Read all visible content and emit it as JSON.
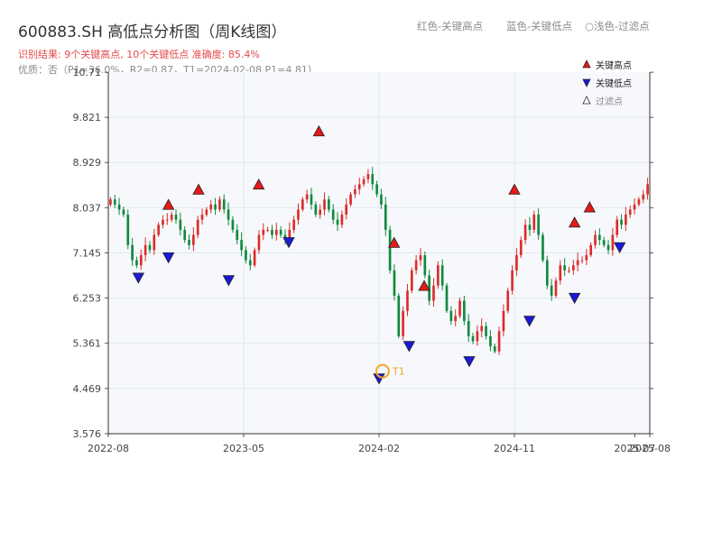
{
  "header": {
    "title": "600883.SH 高低点分析图（周K线图）",
    "result": "识别结果: 9个关键高点, 10个关键低点  准确度: 85.4%",
    "quality": "优质：否（P1=36.0%，R2=0.87，T1=2024-02-08 P1=4.81）"
  },
  "top_legend": [
    {
      "text": "红色-关键高点"
    },
    {
      "text": "蓝色-关键低点"
    },
    {
      "text": "○浅色-过滤点"
    }
  ],
  "colors": {
    "up": "#dc2c2c",
    "down": "#0e8a3e",
    "high_marker": "#e81818",
    "low_marker": "#1a1ad8",
    "t1_ring": "#f5a623",
    "plot_bg": "#f6f8fb"
  },
  "chart_data": {
    "type": "candlestick",
    "title": "600883.SH 高低点分析图（周K线图）",
    "x_tick_labels": [
      "2022-08",
      "2023-05",
      "2024-02",
      "2024-11",
      "2025-07",
      "2025-08"
    ],
    "y_tick_labels": [
      "3.576",
      "4.469",
      "5.361",
      "6.253",
      "7.145",
      "8.037",
      "8.929",
      "9.821",
      "10.71"
    ],
    "ylim": [
      3.576,
      10.713
    ],
    "x_start": "2022-08",
    "x_end": "2025-08",
    "grid": true,
    "legend": {
      "position": "top-right",
      "entries": [
        "关键高点",
        "关键低点",
        "过滤点"
      ]
    },
    "annotation": {
      "label": "T1",
      "date": "2024-02-08",
      "price": 4.81
    },
    "closes": [
      8.2,
      8.1,
      8.0,
      7.9,
      7.3,
      7.0,
      6.9,
      7.1,
      7.3,
      7.2,
      7.5,
      7.7,
      7.8,
      7.8,
      7.9,
      7.8,
      7.6,
      7.4,
      7.3,
      7.5,
      7.8,
      7.9,
      8.0,
      8.1,
      8.0,
      8.2,
      8.0,
      7.8,
      7.6,
      7.4,
      7.2,
      7.0,
      6.9,
      7.2,
      7.5,
      7.6,
      7.6,
      7.5,
      7.6,
      7.5,
      7.4,
      7.6,
      7.8,
      8.0,
      8.2,
      8.3,
      8.1,
      7.9,
      8.0,
      8.2,
      8.0,
      7.8,
      7.7,
      7.9,
      8.1,
      8.3,
      8.4,
      8.5,
      8.6,
      8.7,
      8.5,
      8.3,
      8.1,
      7.6,
      6.8,
      6.3,
      5.5,
      6.0,
      6.4,
      6.8,
      7.0,
      7.1,
      6.7,
      6.2,
      6.5,
      6.9,
      6.5,
      6.0,
      5.8,
      5.9,
      6.2,
      5.8,
      5.5,
      5.4,
      5.6,
      5.7,
      5.5,
      5.3,
      5.2,
      5.6,
      6.0,
      6.4,
      6.8,
      7.1,
      7.4,
      7.7,
      7.6,
      7.9,
      7.5,
      7.0,
      6.5,
      6.3,
      6.6,
      6.9,
      6.8,
      6.8,
      6.9,
      7.0,
      7.0,
      7.1,
      7.3,
      7.5,
      7.4,
      7.3,
      7.2,
      7.5,
      7.8,
      7.7,
      7.9,
      8.0,
      8.1,
      8.2,
      8.3,
      8.5
    ],
    "key_highs": [
      {
        "date": "2022-12",
        "price": 7.95
      },
      {
        "date": "2023-02",
        "price": 8.25
      },
      {
        "date": "2023-06",
        "price": 8.35
      },
      {
        "date": "2023-10",
        "price": 9.4
      },
      {
        "date": "2024-03",
        "price": 7.2
      },
      {
        "date": "2024-05",
        "price": 6.35
      },
      {
        "date": "2024-11",
        "price": 8.25
      },
      {
        "date": "2025-03",
        "price": 7.6
      },
      {
        "date": "2025-04",
        "price": 7.9
      }
    ],
    "key_lows": [
      {
        "date": "2022-10",
        "price": 6.8
      },
      {
        "date": "2022-12",
        "price": 7.2
      },
      {
        "date": "2023-04",
        "price": 6.75
      },
      {
        "date": "2023-08",
        "price": 7.5
      },
      {
        "date": "2024-02",
        "price": 4.81
      },
      {
        "date": "2024-04",
        "price": 5.45
      },
      {
        "date": "2024-08",
        "price": 5.15
      },
      {
        "date": "2024-12",
        "price": 5.95
      },
      {
        "date": "2025-03",
        "price": 6.4
      },
      {
        "date": "2025-06",
        "price": 7.4
      }
    ]
  }
}
